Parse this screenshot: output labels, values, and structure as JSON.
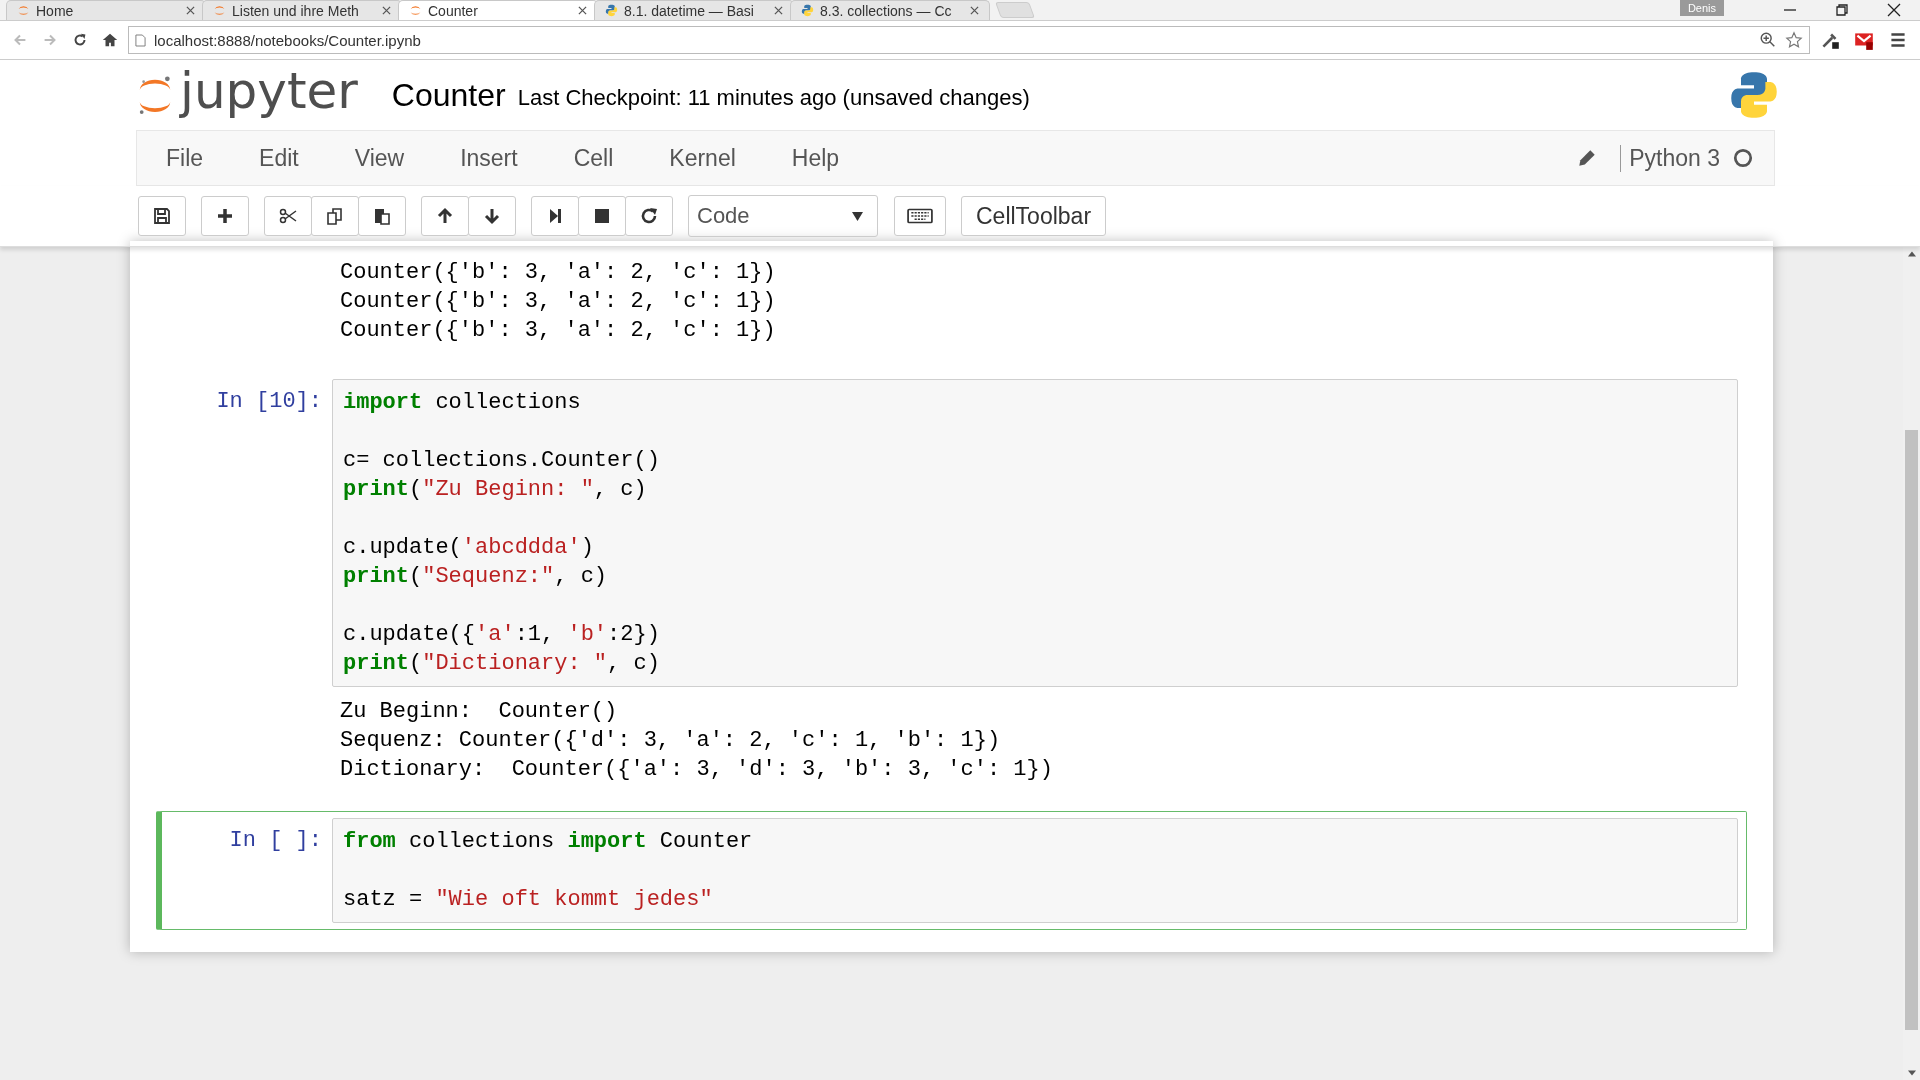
{
  "browser": {
    "tabs": [
      {
        "label": "Home",
        "kind": "jupyter",
        "selected": false
      },
      {
        "label": "Listen und ihre Meth",
        "kind": "jupyter",
        "selected": false
      },
      {
        "label": "Counter",
        "kind": "jupyter",
        "selected": true
      },
      {
        "label": "8.1. datetime — Basi",
        "kind": "python",
        "selected": false
      },
      {
        "label": "8.3. collections — Cc",
        "kind": "python",
        "selected": false
      }
    ],
    "profile": "Denis",
    "address": "localhost:8888/notebooks/Counter.ipynb"
  },
  "header": {
    "logo_text": "jupyter",
    "notebook_name": "Counter",
    "checkpoint": "Last Checkpoint: 11 minutes ago (unsaved changes)"
  },
  "menu": [
    "File",
    "Edit",
    "View",
    "Insert",
    "Cell",
    "Kernel",
    "Help"
  ],
  "kernel": {
    "name": "Python 3",
    "busy": false
  },
  "toolbar": {
    "cell_type": "Code",
    "celltoolbar": "CellToolbar"
  },
  "cells": [
    {
      "selected": false,
      "output": [
        "Counter({'b': 3, 'a': 2, 'c': 1})",
        "Counter({'b': 3, 'a': 2, 'c': 1})",
        "Counter({'b': 3, 'a': 2, 'c': 1})"
      ]
    },
    {
      "prompt": "In [10]:",
      "selected": false,
      "code": [
        {
          "kind": "code",
          "tokens": [
            {
              "t": "import",
              "kind": "keyword"
            },
            {
              "t": " collections",
              "kind": "plain"
            }
          ]
        },
        {
          "kind": "blank"
        },
        {
          "kind": "code",
          "tokens": [
            {
              "t": "c= collections.Counter()",
              "kind": "plain"
            }
          ]
        },
        {
          "kind": "code",
          "tokens": [
            {
              "t": "print",
              "kind": "keyword"
            },
            {
              "t": "(",
              "kind": "plain"
            },
            {
              "t": "\"Zu Beginn: \"",
              "kind": "string"
            },
            {
              "t": ", c)",
              "kind": "plain"
            }
          ]
        },
        {
          "kind": "blank"
        },
        {
          "kind": "code",
          "tokens": [
            {
              "t": "c.update(",
              "kind": "plain"
            },
            {
              "t": "'abcddda'",
              "kind": "string"
            },
            {
              "t": ")",
              "kind": "plain"
            }
          ]
        },
        {
          "kind": "code",
          "tokens": [
            {
              "t": "print",
              "kind": "keyword"
            },
            {
              "t": "(",
              "kind": "plain"
            },
            {
              "t": "\"Sequenz:\"",
              "kind": "string"
            },
            {
              "t": ", c)",
              "kind": "plain"
            }
          ]
        },
        {
          "kind": "blank"
        },
        {
          "kind": "code",
          "tokens": [
            {
              "t": "c.update({",
              "kind": "plain"
            },
            {
              "t": "'a'",
              "kind": "string"
            },
            {
              "t": ":1, ",
              "kind": "plain"
            },
            {
              "t": "'b'",
              "kind": "string"
            },
            {
              "t": ":2})",
              "kind": "plain"
            }
          ]
        },
        {
          "kind": "code",
          "tokens": [
            {
              "t": "print",
              "kind": "keyword"
            },
            {
              "t": "(",
              "kind": "plain"
            },
            {
              "t": "\"Dictionary: \"",
              "kind": "string"
            },
            {
              "t": ", c)",
              "kind": "plain"
            }
          ]
        }
      ],
      "output": [
        "Zu Beginn:  Counter()",
        "Sequenz: Counter({'d': 3, 'a': 2, 'c': 1, 'b': 1})",
        "Dictionary:  Counter({'a': 3, 'd': 3, 'b': 3, 'c': 1})"
      ]
    },
    {
      "prompt": "In [ ]:",
      "selected": true,
      "code": [
        {
          "kind": "code",
          "tokens": [
            {
              "t": "from",
              "kind": "keyword"
            },
            {
              "t": " collections ",
              "kind": "plain"
            },
            {
              "t": "import",
              "kind": "keyword"
            },
            {
              "t": " Counter",
              "kind": "plain"
            }
          ]
        },
        {
          "kind": "blank"
        },
        {
          "kind": "code",
          "tokens": [
            {
              "t": "satz = ",
              "kind": "plain"
            },
            {
              "t": "\"Wie oft kommt jedes\"",
              "kind": "string"
            }
          ]
        }
      ]
    }
  ]
}
